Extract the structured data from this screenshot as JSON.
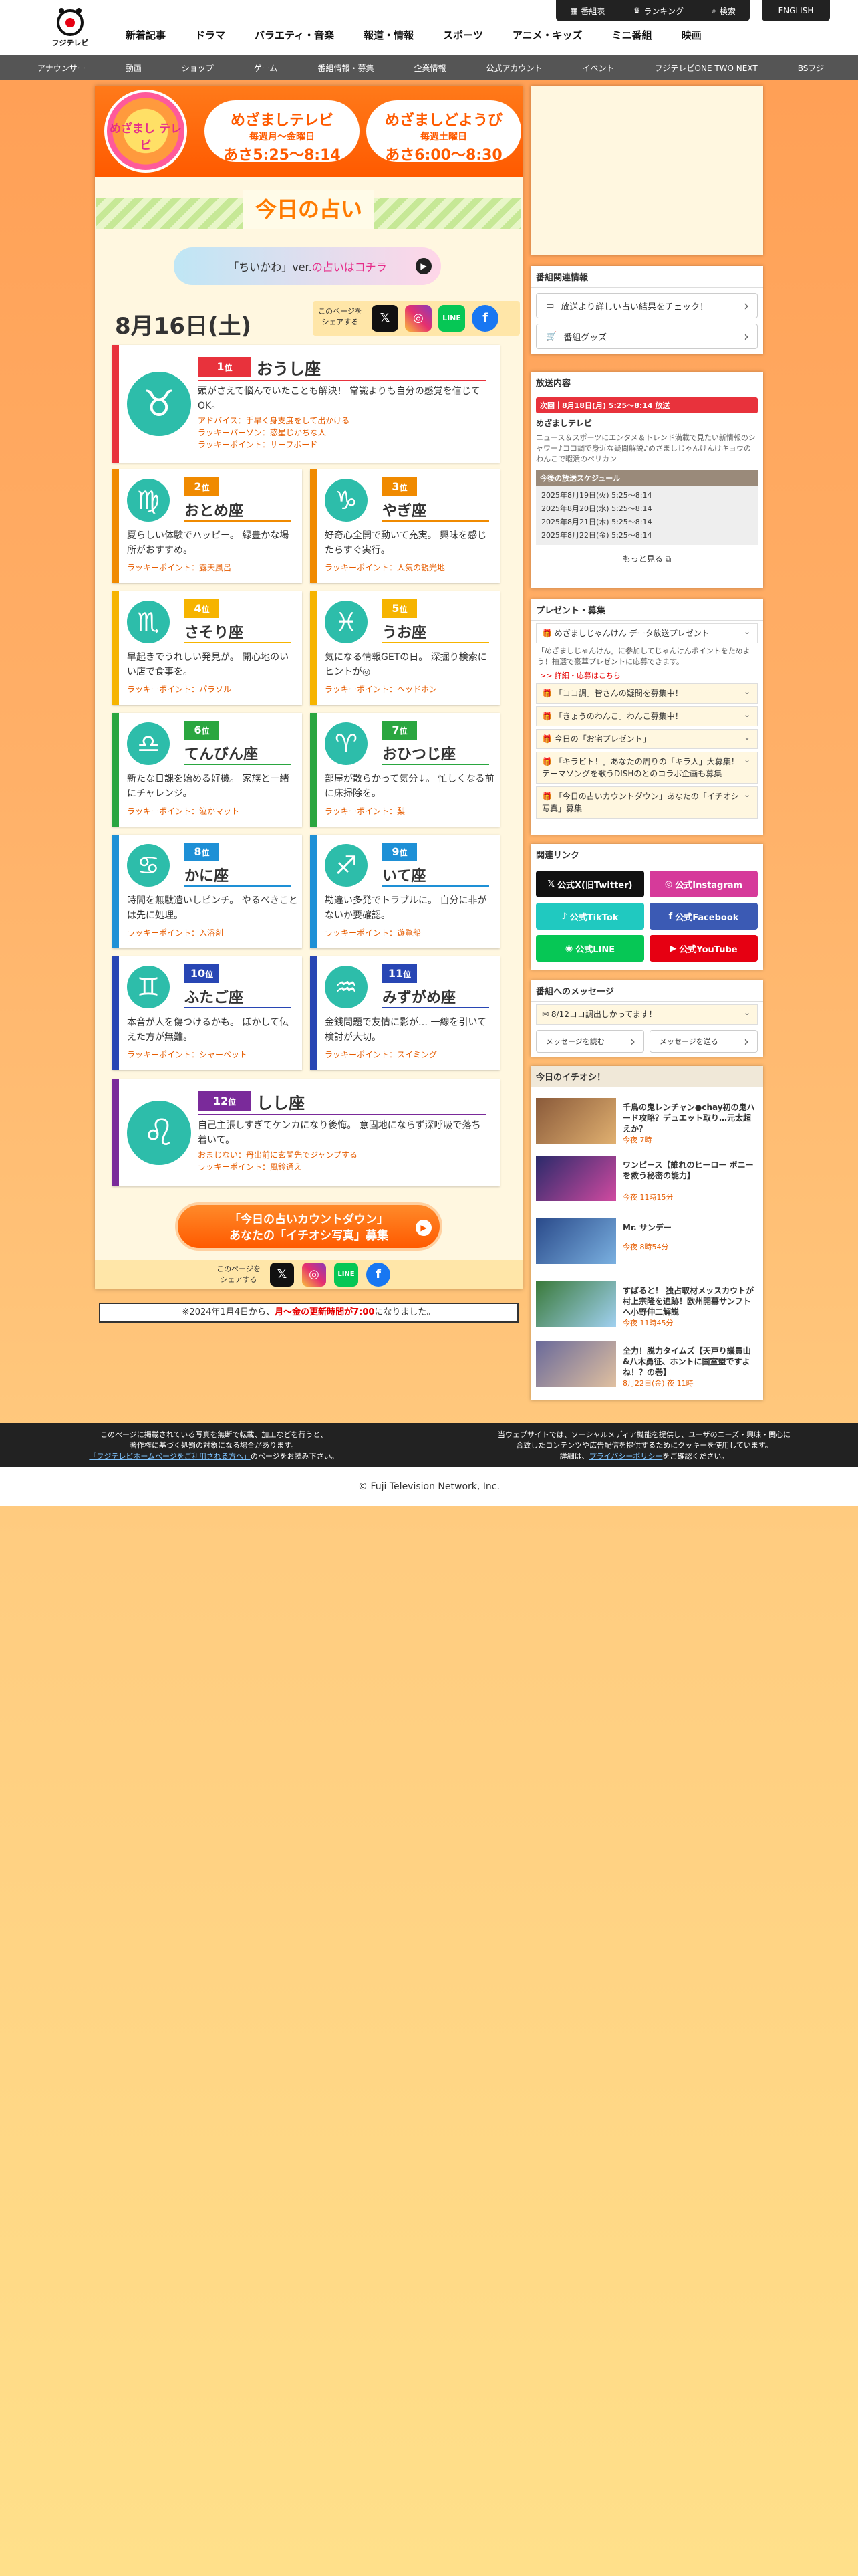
{
  "header": {
    "logo_text": "フジテレビ",
    "nav": [
      "新着記事",
      "ドラマ",
      "バラエティ・音楽",
      "報道・情報",
      "スポーツ",
      "アニメ・キッズ",
      "ミニ番組",
      "映画"
    ],
    "tools": [
      "番組表",
      "ランキング",
      "検索"
    ],
    "english": "ENGLISH"
  },
  "subnav": [
    "アナウンサー",
    "動画",
    "ショップ",
    "ゲーム",
    "番組情報・募集",
    "企業情報",
    "公式アカウント",
    "イベント",
    "フジテレビONE TWO NEXT",
    "BSフジ"
  ],
  "banner": {
    "logo": "めざまし テレビ",
    "left_title": "めざましテレビ",
    "left_days": "毎週月〜金曜日",
    "left_time": "あさ5:25〜8:14",
    "right_title": "めざましどようび",
    "right_days": "毎週土曜日",
    "right_time": "あさ6:00〜8:30"
  },
  "page_title": "今日の占い",
  "chiikawa": {
    "prefix": "「ちいかわ」ver.",
    "highlight": "の占いはコチラ"
  },
  "date": "8月16日(土)",
  "share_label": "このページを シェアする",
  "share_icons": [
    "X",
    "Instagram",
    "LINE",
    "Facebook"
  ],
  "fortunes": [
    {
      "rank": "1",
      "sign": "おうし座",
      "glyph": "♉",
      "color": "#e8323c",
      "desc": "頭がさえて悩んでいたことも解決！ 常識よりも自分の感覚を信じてOK。",
      "advice": "アドバイス：手早く身支度をして出かける",
      "lucky1": "ラッキーパーソン：惑星じかちな人",
      "lucky2": "ラッキーポイント：サーフボード"
    },
    {
      "rank": "2",
      "sign": "おとめ座",
      "glyph": "♍",
      "color": "#f08a00",
      "desc": "夏らしい体験でハッピー。 緑豊かな場所がおすすめ。",
      "lucky": "ラッキーポイント：露天風呂"
    },
    {
      "rank": "3",
      "sign": "やぎ座",
      "glyph": "♑",
      "color": "#f08a00",
      "desc": "好奇心全開で動いて充実。 興味を感じたらすぐ実行。",
      "lucky": "ラッキーポイント：人気の観光地"
    },
    {
      "rank": "4",
      "sign": "さそり座",
      "glyph": "♏",
      "color": "#f6b400",
      "desc": "早起きでうれしい発見が。 開心地のいい店で食事を。",
      "lucky": "ラッキーポイント：パラソル"
    },
    {
      "rank": "5",
      "sign": "うお座",
      "glyph": "♓",
      "color": "#f6b400",
      "desc": "気になる情報GETの日。 深掘り検索にヒントが◎",
      "lucky": "ラッキーポイント：ヘッドホン"
    },
    {
      "rank": "6",
      "sign": "てんびん座",
      "glyph": "♎",
      "color": "#2aa640",
      "desc": "新たな日課を始める好機。 家族と一緒にチャレンジ。",
      "lucky": "ラッキーポイント：泣かマット"
    },
    {
      "rank": "7",
      "sign": "おひつじ座",
      "glyph": "♈",
      "color": "#2aa640",
      "desc": "部屋が散らかって気分↓。 忙しくなる前に床掃除を。",
      "lucky": "ラッキーポイント：梨"
    },
    {
      "rank": "8",
      "sign": "かに座",
      "glyph": "♋",
      "color": "#1e90d6",
      "desc": "時間を無駄遣いしピンチ。 やるべきことは先に処理。",
      "lucky": "ラッキーポイント：入浴剤"
    },
    {
      "rank": "9",
      "sign": "いて座",
      "glyph": "♐",
      "color": "#1e90d6",
      "desc": "勘違い多発でトラブルに。 自分に非がないか要確認。",
      "lucky": "ラッキーポイント：遊覧船"
    },
    {
      "rank": "10",
      "sign": "ふたご座",
      "glyph": "♊",
      "color": "#2846b4",
      "desc": "本音が人を傷つけるかも。 ぼかして伝えた方が無難。",
      "lucky": "ラッキーポイント：シャーベット"
    },
    {
      "rank": "11",
      "sign": "みずがめ座",
      "glyph": "♒",
      "color": "#2846b4",
      "desc": "金銭問題で友情に影が… 一線を引いて検討が大切。",
      "lucky": "ラッキーポイント：スイミング"
    },
    {
      "rank": "12",
      "sign": "しし座",
      "glyph": "♌",
      "color": "#7a2a9a",
      "desc": "自己主張しすぎてケンカになり後悔。 意固地にならず深呼吸で落ち着いて。",
      "advice": "おまじない：丹出前に玄関先でジャンプする",
      "lucky2": "ラッキーポイント：風鈴通え"
    }
  ],
  "cta": {
    "line1": "「今日の占いカウントダウン」",
    "line2": "あなたの「イチオシ写真」募集"
  },
  "notice": {
    "pre": "※2024年1月4日から、",
    "red": "月〜金の更新時間が7:00",
    "post": "になりました。"
  },
  "side_info": {
    "title": "番組関連情報",
    "btn1": "放送より詳しい占い結果をチェック！",
    "btn2": "番組グッズ"
  },
  "broadcast": {
    "title": "放送内容",
    "next": "次回｜8月18日(月) 5:25〜8:14 放送",
    "program": "めざましテレビ",
    "desc": "ニュース＆スポーツにエンタメ＆トレンド満載で見たい新情報のシャワー♪ココ調で身近な疑問解説♪めざましじゃんけんけキョウのわんこで暇潰のペリカン",
    "sched_title": "今後の放送スケジュール",
    "schedule": [
      "2025年8月19日(火) 5:25〜8:14",
      "2025年8月20日(水) 5:25〜8:14",
      "2025年8月21日(木) 5:25〜8:14",
      "2025年8月22日(金) 5:25〜8:14"
    ],
    "more": "もっと見る"
  },
  "present": {
    "title": "プレゼント・募集",
    "items": [
      "めざましじゃんけん データ放送プレゼント",
      "「ココ調」皆さんの疑問を募集中！",
      "「きょうのわんこ」わんこ募集中！",
      "今日の「お宅プレゼント」",
      "「キラビト！」あなたの周りの「キラ人」大募集！テーマソングを歌うDISHのとのコラボ企画も募集",
      "「今日の占いカウントダウン」あなたの「イチオシ写真」募集"
    ],
    "desc": "「めざましじゃんけん」に参加してじゃんけんポイントをためよう！抽選で豪華プレゼントに応募できます。",
    "link": ">> 詳細・応募はこちら"
  },
  "links": {
    "title": "関連リンク",
    "items": [
      "公式X(旧Twitter)",
      "公式Instagram",
      "公式TikTok",
      "公式Facebook",
      "公式LINE",
      "公式YouTube"
    ]
  },
  "message": {
    "title": "番組へのメッセージ",
    "item": "8/12ココ調出しかってます！",
    "read": "メッセージを読む",
    "send": "メッセージを送る"
  },
  "ichioshi": {
    "title": "今日のイチオシ！",
    "items": [
      {
        "title": "千鳥の鬼レンチャン●chay初の鬼ハード攻略？デュエット取り…元太超えか？",
        "time": "今夜 7時"
      },
      {
        "title": "ワンピース【誰れのヒーロー ボニーを救う秘密の能力】",
        "time": "今夜 11時15分"
      },
      {
        "title": "Mr. サンデー",
        "time": "今夜 8時54分"
      },
      {
        "title": "すばると！ 独占取材メッスカウトが村上宗隆を追跡！欧州開幕サンフトへ小野伸二解説",
        "time": "今夜 11時45分"
      },
      {
        "title": "全力！脱力タイムズ【天戸り議員山&八木勇征、ホントに国室盟ですよね！？の巻】",
        "time": "8月22日(金) 夜 11時"
      }
    ]
  },
  "footer": {
    "left1": "このページに掲載されている写真を無断で転載、加工などを行うと、",
    "left2": "著作権に基づく処罰の対象になる場合があります。",
    "left3_link": "「フジテレビホームページをご利用される方へ」",
    "left3": "のページをお読み下さい。",
    "right1": "当ウェブサイトでは、ソーシャルメディア機能を提供し、ユーザのニーズ・興味・関心に",
    "right2": "合致したコンテンツや広告配信を提供するためにクッキーを使用しています。",
    "right3_pre": "詳細は、",
    "right3_link": "プライバシーポリシー",
    "right3_post": "をご確認ください。"
  },
  "copyright": "© Fuji Television Network, Inc."
}
